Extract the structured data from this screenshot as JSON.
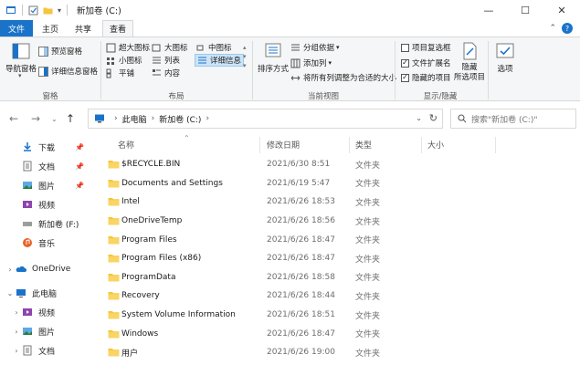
{
  "titlebar": {
    "title": "新加卷 (C:)",
    "controls": [
      "—",
      "☐",
      "✕"
    ]
  },
  "ribbon_tabs": [
    "文件",
    "主页",
    "共享",
    "查看"
  ],
  "ribbon": {
    "panes": {
      "label": "窗格",
      "nav_pane": "导航窗格",
      "preview_pane": "预览窗格",
      "details_pane": "详细信息窗格"
    },
    "layout": {
      "label": "布局",
      "extra_large_icons": "超大图标",
      "large_icons": "大图标",
      "medium_icons": "中图标",
      "small_icons": "小图标",
      "list": "列表",
      "details": "详细信息",
      "tiles": "平铺",
      "content": "内容"
    },
    "current_view": {
      "label": "当前视图",
      "sort_by": "排序方式",
      "group_by": "分组依据",
      "add_columns": "添加列",
      "fit_columns": "将所有列调整为合适的大小"
    },
    "show_hide": {
      "label": "显示/隐藏",
      "item_checkboxes": "项目复选框",
      "item_checkboxes_checked": false,
      "file_extensions": "文件扩展名",
      "file_extensions_checked": true,
      "hidden_items": "隐藏的项目",
      "hidden_items_checked": true,
      "hide_selected": "隐藏\n所选项目"
    },
    "options": "选项"
  },
  "address": {
    "crumbs": [
      "此电脑",
      "新加卷 (C:)"
    ],
    "search_placeholder": "搜索\"新加卷 (C:)\""
  },
  "navpane": {
    "quick": [
      {
        "label": "下载",
        "icon": "download-icon"
      },
      {
        "label": "文档",
        "icon": "document-icon"
      },
      {
        "label": "图片",
        "icon": "picture-icon"
      },
      {
        "label": "视频",
        "icon": "video-icon"
      },
      {
        "label": "新加卷 (F:)",
        "icon": "drive-icon"
      },
      {
        "label": "音乐",
        "icon": "music-icon"
      }
    ],
    "onedrive": "OneDrive",
    "this_pc": "此电脑",
    "pc_children": [
      "视频",
      "图片",
      "文档"
    ]
  },
  "columns": {
    "name": "名称",
    "date": "修改日期",
    "type": "类型",
    "size": "大小"
  },
  "files": [
    {
      "name": "$RECYCLE.BIN",
      "date": "2021/6/30 8:51",
      "type": "文件夹"
    },
    {
      "name": "Documents and Settings",
      "date": "2021/6/19 5:47",
      "type": "文件夹"
    },
    {
      "name": "Intel",
      "date": "2021/6/26 18:53",
      "type": "文件夹"
    },
    {
      "name": "OneDriveTemp",
      "date": "2021/6/26 18:56",
      "type": "文件夹"
    },
    {
      "name": "Program Files",
      "date": "2021/6/26 18:47",
      "type": "文件夹"
    },
    {
      "name": "Program Files (x86)",
      "date": "2021/6/26 18:47",
      "type": "文件夹"
    },
    {
      "name": "ProgramData",
      "date": "2021/6/26 18:58",
      "type": "文件夹"
    },
    {
      "name": "Recovery",
      "date": "2021/6/26 18:44",
      "type": "文件夹"
    },
    {
      "name": "System Volume Information",
      "date": "2021/6/26 18:51",
      "type": "文件夹"
    },
    {
      "name": "Windows",
      "date": "2021/6/26 18:47",
      "type": "文件夹"
    },
    {
      "name": "用户",
      "date": "2021/6/26 19:00",
      "type": "文件夹"
    }
  ],
  "colors": {
    "accent": "#1a73c9",
    "folder": "#f5c53b",
    "ribbon_bg": "#f5f6f7",
    "selected": "#cce4f7"
  }
}
